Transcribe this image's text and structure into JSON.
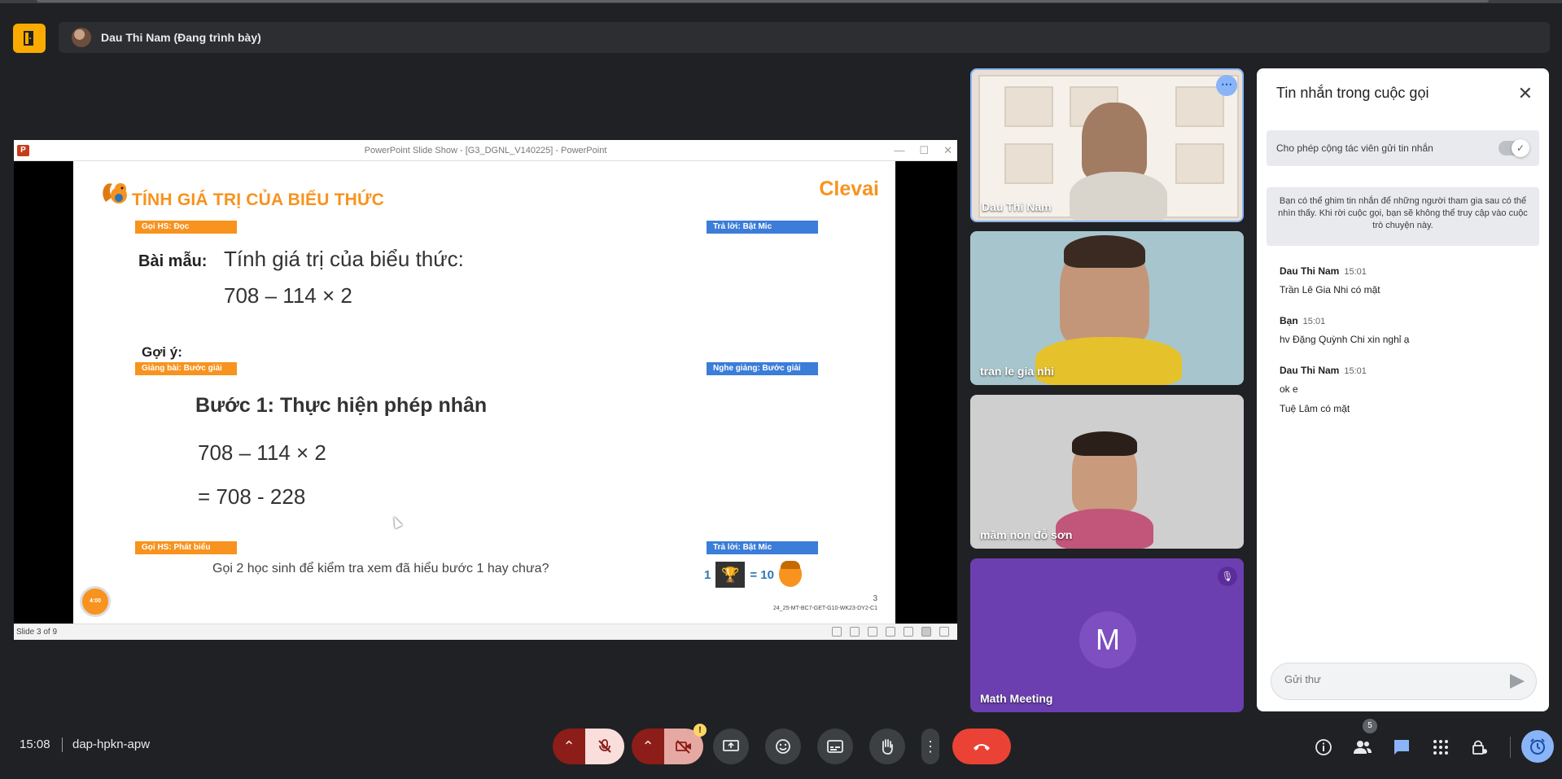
{
  "presenter": {
    "name": "Dau Thi Nam (Đang trình bày)"
  },
  "ppt": {
    "window_title": "PowerPoint Slide Show - [G3_DGNL_V140225] - PowerPoint",
    "icon_letter": "P",
    "status": "Slide 3 of 9"
  },
  "slide": {
    "title": "TÍNH GIÁ TRỊ CỦA BIỂU THỨC",
    "brand": "Clevai",
    "tag_student_read": "Gọi HS: Đọc",
    "tag_answer_mic_1": "Trả lời: Bật Mic",
    "sample_label": "Bài mẫu:",
    "sample_task": "Tính giá trị của biểu thức:",
    "sample_expr": "708 – 114 × 2",
    "hint_label": "Gợi ý:",
    "tag_teach_step": "Giảng bài: Bước giải",
    "tag_listen_step": "Nghe giảng: Bước giải",
    "step_title": "Bước 1: Thực hiện phép nhân",
    "step_expr1": "708 – 114 × 2",
    "step_expr2": "= 708 - 228",
    "tag_student_speak": "Gọi HS: Phát biểu",
    "tag_answer_mic_2": "Trả lời: Bật Mic",
    "question": "Gọi 2 học sinh để kiểm tra xem đã hiểu bước 1 hay chưa?",
    "score_count": "1",
    "score_value": "= 10",
    "timer": "4:00",
    "page_number": "3",
    "code": "24_25-MT-BC7-GET-G10-WK23-DY2-C1"
  },
  "participants": [
    {
      "name": "Dau Thi Nam"
    },
    {
      "name": "tran le gia nhi"
    },
    {
      "name": "mầm non đỗ sơn"
    },
    {
      "name": "Math Meeting",
      "initial": "M"
    }
  ],
  "chat": {
    "title": "Tin nhắn trong cuộc gọi",
    "toggle_label": "Cho phép cộng tác viên gửi tin nhắn",
    "toggle_on": true,
    "note": "Bạn có thể ghim tin nhắn để những người tham gia sau có thể nhìn thấy. Khi rời cuộc gọi, bạn sẽ không thể truy cập vào cuộc trò chuyện này.",
    "messages": [
      {
        "sender": "Dau Thi Nam",
        "time": "15:01",
        "lines": [
          "Trần Lê Gia Nhi có mặt"
        ]
      },
      {
        "sender": "Bạn",
        "time": "15:01",
        "lines": [
          "hv Đặng Quỳnh Chi xin nghỉ ạ"
        ]
      },
      {
        "sender": "Dau Thi Nam",
        "time": "15:01",
        "lines": [
          "ok e",
          "Tuệ Lâm có mặt"
        ]
      }
    ],
    "input_placeholder": "Gửi thư"
  },
  "bottom": {
    "time": "15:08",
    "meeting_code": "dap-hpkn-apw",
    "people_count": "5"
  },
  "colors": {
    "background": "#202124",
    "accent_orange": "#f7931e",
    "accent_blue": "#3b7dd8",
    "hangup_red": "#ea4335",
    "highlight_blue": "#8ab4f8"
  },
  "icons": {
    "corner": "door-exit-icon",
    "mic": "mic-off-icon",
    "camera": "camera-off-icon",
    "present": "present-screen-icon",
    "emoji": "emoji-icon",
    "captions": "captions-icon",
    "hand": "raise-hand-icon",
    "more": "more-vert-icon",
    "hangup": "call-end-icon",
    "info": "info-icon",
    "people": "people-icon",
    "chat": "chat-icon",
    "apps": "apps-icon",
    "host": "host-controls-icon",
    "timer": "timer-icon"
  }
}
